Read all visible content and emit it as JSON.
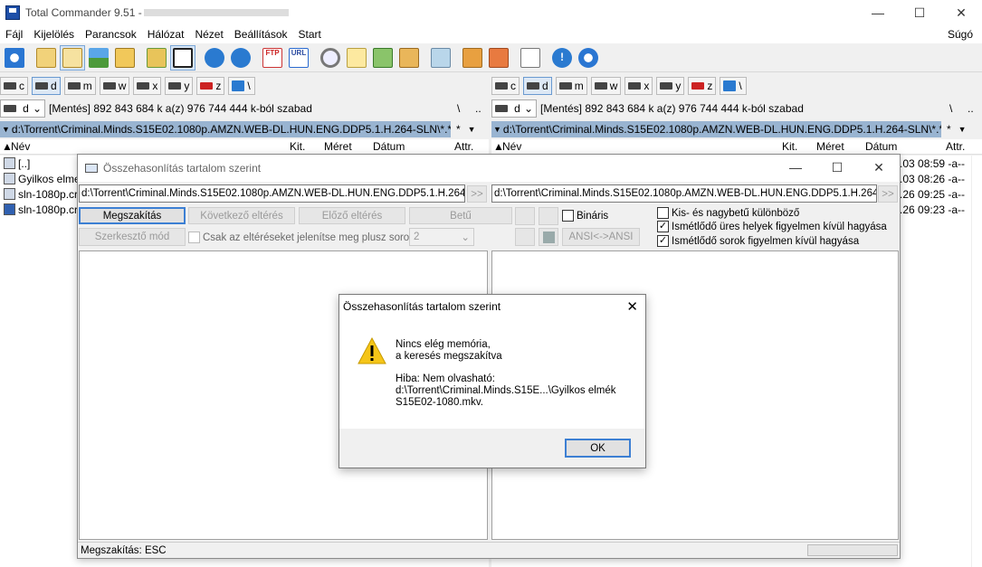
{
  "app": {
    "title": "Total Commander 9.51 - ",
    "title_obscured": ""
  },
  "window_buttons": {
    "minimize": "—",
    "maximize": "☐",
    "close": "✕"
  },
  "menu": {
    "items": [
      "Fájl",
      "Kijelölés",
      "Parancsok",
      "Hálózat",
      "Nézet",
      "Beállítások",
      "Start"
    ],
    "help": "Súgó"
  },
  "toolbar": {
    "icons": [
      "refresh-icon",
      "brief-view-icon",
      "detailed-view-icon",
      "thumbnails-icon",
      "tree-icon",
      "swap-panels-icon",
      "invert-selection-icon",
      "back-icon",
      "forward-icon",
      "ftp-icon",
      "url-icon",
      "search-icon",
      "multi-rename-icon",
      "sync-dirs-icon",
      "edit-icon",
      "notepad-icon",
      "pack-icon",
      "unpack-icon",
      "copy-names-icon",
      "info-icon",
      "sync-icon"
    ]
  },
  "left": {
    "drives": [
      "c",
      "d",
      "m",
      "w",
      "x",
      "y",
      "z",
      "\\"
    ],
    "drive_selected": "d",
    "drive_label": "[Mentés]",
    "free_text": "892 843 684 k a(z) 976 744 444 k-ból szabad",
    "root": "\\",
    "up": "..",
    "path": "d:\\Torrent\\Criminal.Minds.S15E02.1080p.AMZN.WEB-DL.HUN.ENG.DDP5.1.H.264-SLN\\*.*",
    "star": "*",
    "columns": [
      "Név",
      "Kit.",
      "Méret",
      "Dátum",
      "Attr."
    ],
    "files": [
      {
        "name": "[..]",
        "icon": "up-dir-icon"
      },
      {
        "name": "Gyilkos elme",
        "icon": "video-file-icon"
      },
      {
        "name": "sln-1080p.cr",
        "icon": "video-file-icon"
      },
      {
        "name": "sln-1080p.cr",
        "icon": "nfo-file-icon"
      }
    ]
  },
  "right": {
    "drives": [
      "c",
      "d",
      "m",
      "w",
      "x",
      "y",
      "z",
      "\\"
    ],
    "drive_selected": "d",
    "drive_label": "[Mentés]",
    "free_text": "892 843 684 k a(z) 976 744 444 k-ból szabad",
    "root": "\\",
    "up": "..",
    "path": "d:\\Torrent\\Criminal.Minds.S15E02.1080p.AMZN.WEB-DL.HUN.ENG.DDP5.1.H.264-SLN\\*.*",
    "star": "*",
    "columns": [
      "Név",
      "Kit.",
      "Méret",
      "Dátum",
      "Attr."
    ],
    "files": [
      {
        "date": ".03 08:59",
        "attr": "-a--"
      },
      {
        "date": ".03 08:26",
        "attr": "-a--"
      },
      {
        "date": ".26 09:25",
        "attr": "-a--"
      },
      {
        "date": ".26 09:23",
        "attr": "-a--"
      }
    ]
  },
  "compare": {
    "title": "Összehasonlítás tartalom szerint",
    "left_path": "d:\\Torrent\\Criminal.Minds.S15E02.1080p.AMZN.WEB-DL.HUN.ENG.DDP5.1.H.264-SLN",
    "right_path": "d:\\Torrent\\Criminal.Minds.S15E02.1080p.AMZN.WEB-DL.HUN.ENG.DDP5.1.H.264-SLN",
    "browse": ">>",
    "buttons": {
      "abort": "Megszakítás",
      "next": "Következő eltérés",
      "prev": "Előző eltérés",
      "font": "Betű",
      "editor": "Szerkesztő mód",
      "ansi": "ANSI<->ANSI"
    },
    "only_diff": "Csak az eltéréseket jelenítse meg plusz sorok:",
    "lines_value": "2",
    "binary": "Bináris",
    "options": [
      {
        "label": "Kis- és nagybetű különböző",
        "checked": false
      },
      {
        "label": "Ismétlődő üres helyek figyelmen kívül hagyása",
        "checked": true
      },
      {
        "label": "Ismétlődő sorok figyelmen kívül hagyása",
        "checked": true
      }
    ],
    "status": "Megszakítás: ESC"
  },
  "dialog": {
    "title": "Összehasonlítás tartalom szerint",
    "line1": "Nincs elég memória,",
    "line2": "a keresés megszakítva",
    "line3": "Hiba: Nem olvasható:",
    "line4": "d:\\Torrent\\Criminal.Minds.S15E...\\Gyilkos elmék",
    "line5": "S15E02-1080.mkv.",
    "ok": "OK",
    "close": "✕"
  }
}
